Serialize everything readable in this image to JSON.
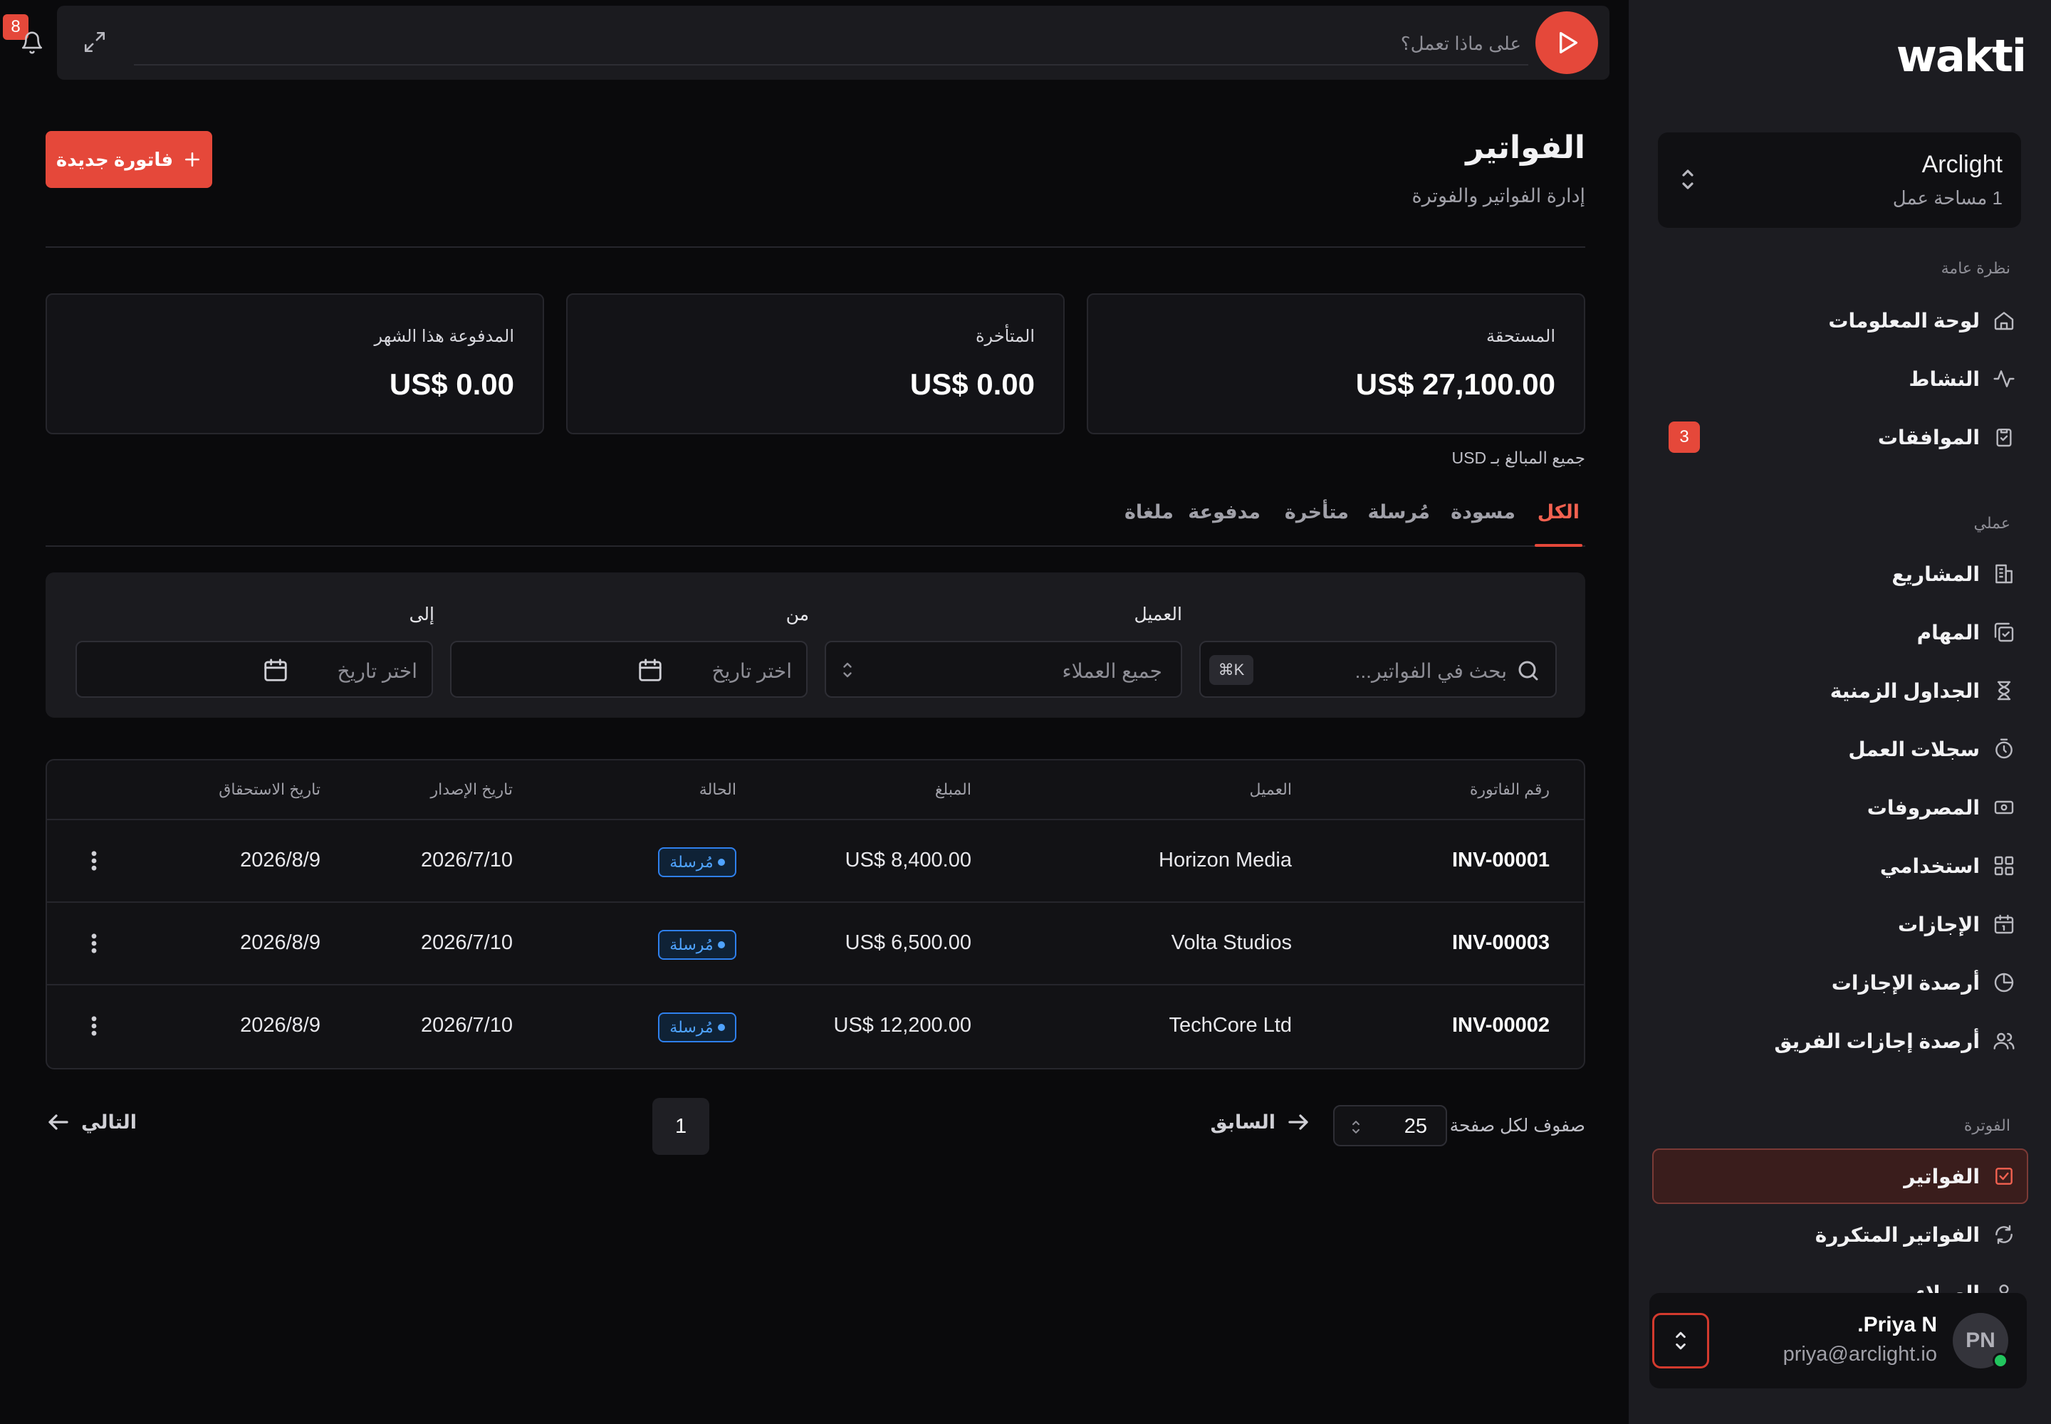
{
  "app": {
    "logo": "wakti"
  },
  "topbar": {
    "ask_placeholder": "على ماذا تعمل؟",
    "notifications_count": "8"
  },
  "workspace": {
    "name": "Arclight",
    "subtitle": "1 مساحة عمل"
  },
  "sidebar": {
    "sections": [
      {
        "heading": "نظرة عامة",
        "items": [
          {
            "label": "لوحة المعلومات",
            "icon": "home-icon"
          },
          {
            "label": "النشاط",
            "icon": "activity-icon"
          },
          {
            "label": "الموافقات",
            "icon": "clipboard-check-icon",
            "badge": "3"
          }
        ]
      },
      {
        "heading": "عملي",
        "items": [
          {
            "label": "المشاريع",
            "icon": "building-icon"
          },
          {
            "label": "المهام",
            "icon": "tasks-icon"
          },
          {
            "label": "الجداول الزمنية",
            "icon": "hourglass-icon"
          },
          {
            "label": "سجلات العمل",
            "icon": "timer-icon"
          },
          {
            "label": "المصروفات",
            "icon": "cash-icon"
          },
          {
            "label": "استخدامي",
            "icon": "grid-icon"
          },
          {
            "label": "الإجازات",
            "icon": "calendar-icon"
          },
          {
            "label": "أرصدة الإجازات",
            "icon": "pie-chart-icon"
          },
          {
            "label": "أرصدة إجازات الفريق",
            "icon": "team-icon"
          }
        ]
      },
      {
        "heading": "الفوترة",
        "items": [
          {
            "label": "الفواتير",
            "icon": "invoice-icon",
            "active": true
          },
          {
            "label": "الفواتير المتكررة",
            "icon": "refresh-icon"
          },
          {
            "label": "العملاء",
            "icon": "user-icon"
          }
        ]
      }
    ]
  },
  "user": {
    "initials": "PN",
    "name": "Priya N.",
    "email": "priya@arclight.io"
  },
  "page": {
    "title": "الفواتير",
    "subtitle": "إدارة الفواتير والفوترة",
    "new_button": "فاتورة جديدة",
    "currency_note": "جميع المبالغ بـ USD"
  },
  "stats": [
    {
      "label": "المستحقة",
      "value": "US$ 27,100.00"
    },
    {
      "label": "المتأخرة",
      "value": "US$ 0.00"
    },
    {
      "label": "المدفوعة هذا الشهر",
      "value": "US$ 0.00"
    }
  ],
  "tabs": [
    "الكل",
    "مسودة",
    "مُرسلة",
    "متأخرة",
    "مدفوعة",
    "ملغاة"
  ],
  "active_tab": "الكل",
  "filters": {
    "search_placeholder": "بحث في الفواتير...",
    "search_shortcut": "⌘K",
    "client_label": "العميل",
    "client_value": "جميع العملاء",
    "from_label": "من",
    "from_placeholder": "اختر تاريخ",
    "to_label": "إلى",
    "to_placeholder": "اختر تاريخ"
  },
  "table": {
    "headers": {
      "number": "رقم الفاتورة",
      "client": "العميل",
      "amount": "المبلغ",
      "status": "الحالة",
      "issued": "تاريخ الإصدار",
      "due": "تاريخ الاستحقاق"
    },
    "rows": [
      {
        "number": "INV-00001",
        "client": "Horizon Media",
        "amount": "US$ 8,400.00",
        "status": "مُرسلة",
        "issued": "2026/7/10",
        "due": "2026/8/9"
      },
      {
        "number": "INV-00003",
        "client": "Volta Studios",
        "amount": "US$ 6,500.00",
        "status": "مُرسلة",
        "issued": "2026/7/10",
        "due": "2026/8/9"
      },
      {
        "number": "INV-00002",
        "client": "TechCore Ltd",
        "amount": "US$ 12,200.00",
        "status": "مُرسلة",
        "issued": "2026/7/10",
        "due": "2026/8/9"
      }
    ]
  },
  "pagination": {
    "rows_label": "صفوف لكل صفحة",
    "rows_value": "25",
    "prev_label": "السابق",
    "page": "1",
    "next_label": "التالي"
  },
  "colors": {
    "accent": "#e5483a",
    "status_sent": "#4fa3ff",
    "background": "#0a0a0c",
    "sidebar": "#1c1c21"
  }
}
